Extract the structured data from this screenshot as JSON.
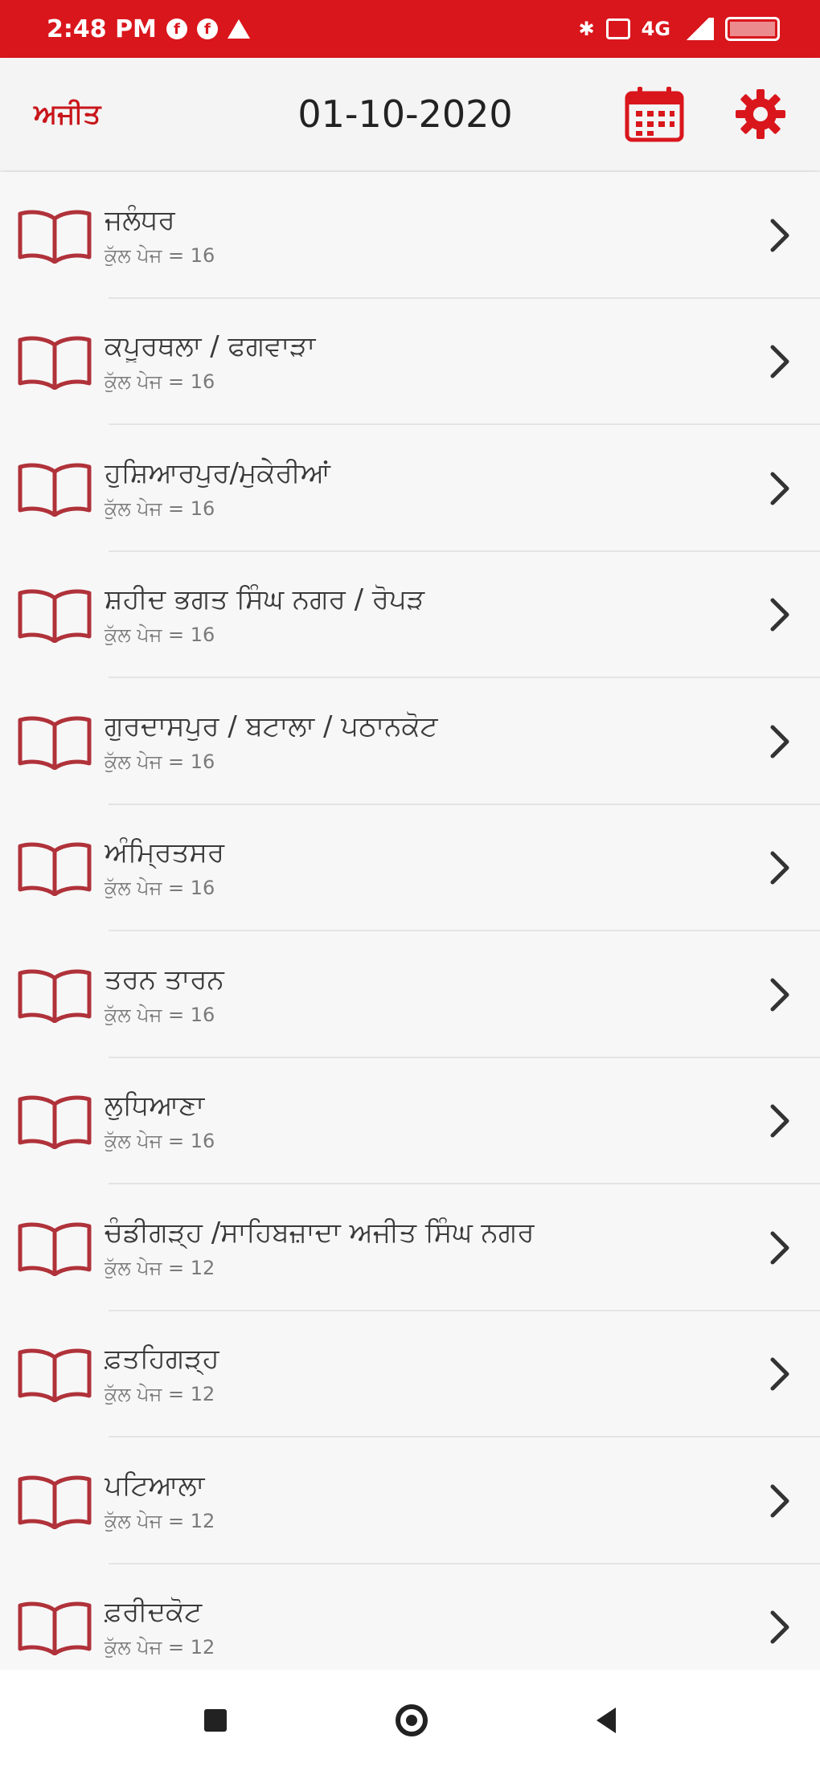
{
  "status_bar": {
    "time": "2:48 PM",
    "network": "4G"
  },
  "app_bar": {
    "brand": "ਅਜੀਤ",
    "date": "01-10-2020",
    "calendar_icon": "calendar-icon",
    "settings_icon": "gear-icon",
    "accent_color": "#d9161c"
  },
  "list": {
    "items": [
      {
        "title": "ਜਲੰਧਰ",
        "subtitle": "ਕੁੱਲ ਪੇਜ = 16"
      },
      {
        "title": "ਕਪੂਰਥਲਾ / ਫਗਵਾੜਾ",
        "subtitle": "ਕੁੱਲ ਪੇਜ = 16"
      },
      {
        "title": "ਹੁਸ਼ਿਆਰਪੁਰ/ਮੁਕੇਰੀਆਂ",
        "subtitle": "ਕੁੱਲ ਪੇਜ = 16"
      },
      {
        "title": "ਸ਼ਹੀਦ ਭਗਤ ਸਿੰਘ ਨਗਰ / ਰੋਪੜ",
        "subtitle": "ਕੁੱਲ ਪੇਜ = 16"
      },
      {
        "title": "ਗੁਰਦਾਸਪੁਰ / ਬਟਾਲਾ / ਪਠਾਨਕੋਟ",
        "subtitle": "ਕੁੱਲ ਪੇਜ = 16"
      },
      {
        "title": "ਅੰਮ੍ਰਿਤਸਰ",
        "subtitle": "ਕੁੱਲ ਪੇਜ = 16"
      },
      {
        "title": "ਤਰਨ ਤਾਰਨ",
        "subtitle": "ਕੁੱਲ ਪੇਜ = 16"
      },
      {
        "title": "ਲੁਧਿਆਣਾ",
        "subtitle": "ਕੁੱਲ ਪੇਜ = 16"
      },
      {
        "title": "ਚੰਡੀਗੜ੍ਹ /ਸਾਹਿਬਜ਼ਾਦਾ ਅਜੀਤ ਸਿੰਘ ਨਗਰ",
        "subtitle": "ਕੁੱਲ ਪੇਜ = 12"
      },
      {
        "title": "ਫ਼ਤਹਿਗੜ੍ਹ",
        "subtitle": "ਕੁੱਲ ਪੇਜ = 12"
      },
      {
        "title": "ਪਟਿਆਲਾ",
        "subtitle": "ਕੁੱਲ ਪੇਜ = 12"
      },
      {
        "title": "ਫ਼ਰੀਦਕੋਟ",
        "subtitle": "ਕੁੱਲ ਪੇਜ = 12"
      }
    ],
    "row_icon": "book-icon",
    "chevron_icon": "chevron-right-icon"
  },
  "nav_bar": {
    "recents_icon": "square-icon",
    "home_icon": "circle-icon",
    "back_icon": "back-triangle-icon"
  }
}
